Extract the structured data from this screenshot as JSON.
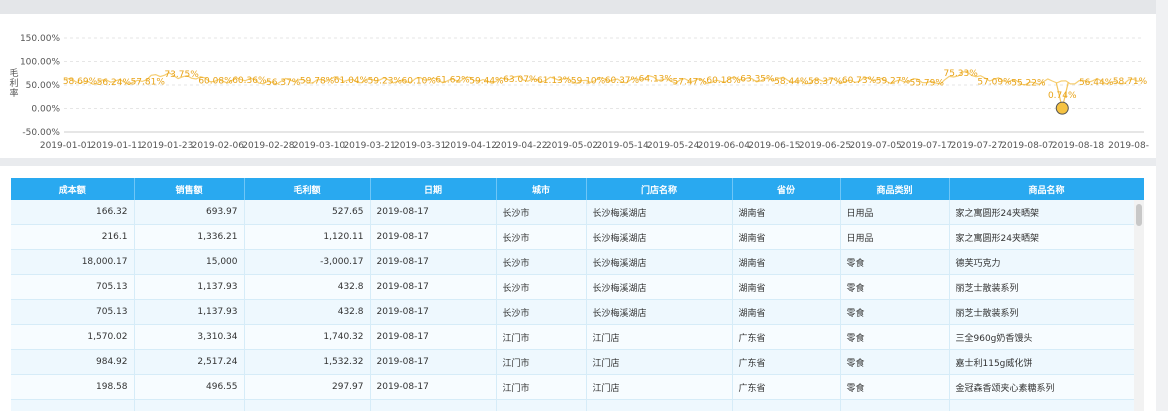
{
  "chart": {
    "ylabel": "毛利率",
    "yticks": [
      "150.00%",
      "100.00%",
      "50.00%",
      "0.00%",
      "-50.00%"
    ],
    "xticks": [
      "2019-01-01",
      "2019-01-11",
      "2019-01-23",
      "2019-02-06",
      "2019-02-28",
      "2019-03-10",
      "2019-03-21",
      "2019-03-31",
      "2019-04-12",
      "2019-04-22",
      "2019-05-02",
      "2019-05-14",
      "2019-05-24",
      "2019-06-04",
      "2019-06-15",
      "2019-06-25",
      "2019-07-05",
      "2019-07-17",
      "2019-07-27",
      "2019-08-07",
      "2019-08-18",
      "2019-08-"
    ],
    "line_color": "#f5c55a",
    "highlight_color": "#f5c242"
  },
  "chart_data": {
    "type": "line",
    "x": [
      "2019-01-01",
      "2019-01-11",
      "2019-01-23",
      "2019-02-06",
      "2019-02-28",
      "2019-03-10",
      "2019-03-21",
      "2019-03-31",
      "2019-04-12",
      "2019-04-22",
      "2019-05-02",
      "2019-05-14",
      "2019-05-24",
      "2019-06-04",
      "2019-06-15",
      "2019-06-25",
      "2019-07-05",
      "2019-07-17",
      "2019-07-27",
      "2019-08-07",
      "2019-08-18",
      "2019-08-"
    ],
    "labels": [
      {
        "text": "58.69%",
        "value": 58.69
      },
      {
        "text": "56.24%",
        "value": 56.24
      },
      {
        "text": "57.81%",
        "value": 57.81
      },
      {
        "text": "73.75%",
        "value": 73.75
      },
      {
        "text": "60.08%",
        "value": 60.08
      },
      {
        "text": "60.36%",
        "value": 60.36
      },
      {
        "text": "56.37%",
        "value": 56.37
      },
      {
        "text": "59.78%",
        "value": 59.78
      },
      {
        "text": "61.04%",
        "value": 61.04
      },
      {
        "text": "59.23%",
        "value": 59.23
      },
      {
        "text": "60.10%",
        "value": 60.1
      },
      {
        "text": "61.62%",
        "value": 61.62
      },
      {
        "text": "59.44%",
        "value": 59.44
      },
      {
        "text": "63.07%",
        "value": 63.07
      },
      {
        "text": "61.13%",
        "value": 61.13
      },
      {
        "text": "59.10%",
        "value": 59.1
      },
      {
        "text": "60.37%",
        "value": 60.37
      },
      {
        "text": "64.13%",
        "value": 64.13
      },
      {
        "text": "57.47%",
        "value": 57.47
      },
      {
        "text": "60.18%",
        "value": 60.18
      },
      {
        "text": "63.35%",
        "value": 63.35
      },
      {
        "text": "58.44%",
        "value": 58.44
      },
      {
        "text": "58.37%",
        "value": 58.37
      },
      {
        "text": "60.73%",
        "value": 60.73
      },
      {
        "text": "59.27%",
        "value": 59.27
      },
      {
        "text": "55.79%",
        "value": 55.79
      },
      {
        "text": "75.33%",
        "value": 75.33
      },
      {
        "text": "57.09%",
        "value": 57.09
      },
      {
        "text": "55.22%",
        "value": 55.22
      },
      {
        "text": "0.74%",
        "value": 0.74
      },
      {
        "text": "56.44%",
        "value": 56.44
      },
      {
        "text": "58.71%",
        "value": 58.71
      }
    ],
    "highlight_index": 29,
    "ylabel": "毛利率",
    "ylim": [
      -50,
      150
    ],
    "grid": true
  },
  "table": {
    "headers": [
      "成本额",
      "销售额",
      "毛利额",
      "日期",
      "城市",
      "门店名称",
      "省份",
      "商品类别",
      "商品名称"
    ],
    "rows": [
      [
        "166.32",
        "693.97",
        "527.65",
        "2019-08-17",
        "长沙市",
        "长沙梅溪湖店",
        "湖南省",
        "日用品",
        "家之寓圆形24夹晒架"
      ],
      [
        "216.1",
        "1,336.21",
        "1,120.11",
        "2019-08-17",
        "长沙市",
        "长沙梅溪湖店",
        "湖南省",
        "日用品",
        "家之寓圆形24夹晒架"
      ],
      [
        "18,000.17",
        "15,000",
        "-3,000.17",
        "2019-08-17",
        "长沙市",
        "长沙梅溪湖店",
        "湖南省",
        "零食",
        "德芙巧克力"
      ],
      [
        "705.13",
        "1,137.93",
        "432.8",
        "2019-08-17",
        "长沙市",
        "长沙梅溪湖店",
        "湖南省",
        "零食",
        "丽芝士散装系列"
      ],
      [
        "705.13",
        "1,137.93",
        "432.8",
        "2019-08-17",
        "长沙市",
        "长沙梅溪湖店",
        "湖南省",
        "零食",
        "丽芝士散装系列"
      ],
      [
        "1,570.02",
        "3,310.34",
        "1,740.32",
        "2019-08-17",
        "江门市",
        "江门店",
        "广东省",
        "零食",
        "三全960g奶香馒头"
      ],
      [
        "984.92",
        "2,517.24",
        "1,532.32",
        "2019-08-17",
        "江门市",
        "江门店",
        "广东省",
        "零食",
        "嘉士利115g威化饼"
      ],
      [
        "198.58",
        "496.55",
        "297.97",
        "2019-08-17",
        "江门市",
        "江门店",
        "广东省",
        "零食",
        "金冠森香颂夹心素糖系列"
      ],
      [
        "",
        "",
        "",
        "",
        "",
        "",
        "",
        "",
        ""
      ]
    ]
  }
}
